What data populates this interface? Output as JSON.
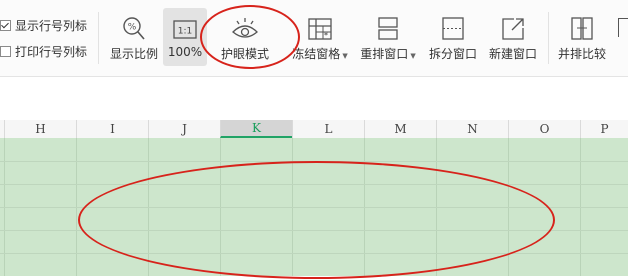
{
  "ribbon": {
    "checkboxes": [
      {
        "label": "显示行号列标",
        "checked": true
      },
      {
        "label": "打印行号列标",
        "checked": false
      }
    ],
    "tools": {
      "zoom": "显示比例",
      "zoom100": "100%",
      "eye_protection": "护眼模式",
      "freeze": "冻结窗格",
      "rearrange": "重排窗口",
      "split": "拆分窗口",
      "new_window": "新建窗口",
      "side_by_side": "并排比较"
    },
    "zoom100_icon_text": "1:1"
  },
  "sheet": {
    "columns": [
      "H",
      "I",
      "J",
      "K",
      "L",
      "M",
      "N",
      "O",
      "P"
    ],
    "active_column": "K",
    "grid_color": "#cde6cc"
  },
  "annotation_color": "#d7231b"
}
